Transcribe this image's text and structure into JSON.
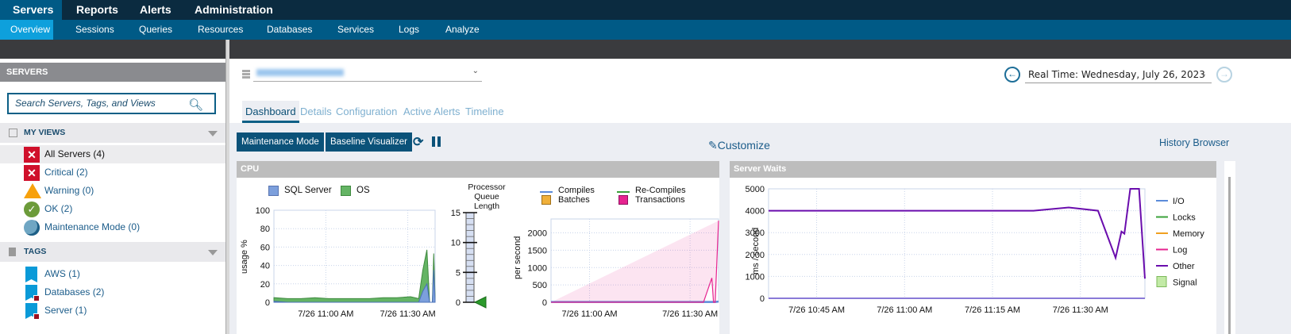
{
  "topnav": {
    "items": [
      "Servers",
      "Reports",
      "Alerts",
      "Administration"
    ],
    "active": "Servers"
  },
  "subnav": {
    "items": [
      "Overview",
      "Sessions",
      "Queries",
      "Resources",
      "Databases",
      "Services",
      "Logs",
      "Analyze"
    ],
    "active": "Overview"
  },
  "sidebar": {
    "title": "SERVERS",
    "search_placeholder": "Search Servers, Tags, and Views",
    "my_views": {
      "label": "MY VIEWS",
      "items": [
        {
          "label": "All Servers (4)",
          "status": "critical",
          "selected": true
        },
        {
          "label": "Critical (2)",
          "status": "critical"
        },
        {
          "label": "Warning (0)",
          "status": "warning"
        },
        {
          "label": "OK (2)",
          "status": "ok"
        },
        {
          "label": "Maintenance Mode (0)",
          "status": "maintenance"
        }
      ]
    },
    "tags": {
      "label": "TAGS",
      "items": [
        {
          "label": "AWS (1)"
        },
        {
          "label": "Databases (2)"
        },
        {
          "label": "Server (1)"
        }
      ]
    }
  },
  "main": {
    "realtime_label": "Real Time: Wednesday, July 26, 2023",
    "tabs": [
      "Dashboard",
      "Details",
      "Configuration",
      "Active Alerts",
      "Timeline"
    ],
    "active_tab": "Dashboard",
    "buttons": {
      "maintenance": "Maintenance Mode",
      "baseline": "Baseline Visualizer"
    },
    "customize": "Customize",
    "history_browser": "History Browser"
  },
  "colors": {
    "sql": "#7c9fdc",
    "os": "#64b464",
    "compiles": "#5b8bd9",
    "recompiles": "#3aa13a",
    "batches": "#f0b03a",
    "transactions": "#e6248f",
    "io": "#5b8bd9",
    "locks": "#3aa13a",
    "memory": "#f0a020",
    "log": "#e6248f",
    "other": "#6a0dad",
    "signal": "#c2eaa6"
  },
  "chart_data": [
    {
      "type": "area",
      "title": "CPU",
      "ylabel": "usage %",
      "ylim": [
        0,
        100
      ],
      "yticks": [
        "0",
        "20",
        "40",
        "60",
        "80",
        "100"
      ],
      "xticks": [
        "7/26 11:00 AM",
        "7/26 11:30 AM"
      ],
      "xticks_min": [
        0,
        30
      ],
      "xlim_min": [
        -19,
        40
      ],
      "legend": [
        "SQL Server",
        "OS"
      ],
      "x_min": [
        -19,
        -14,
        -9,
        -4,
        1,
        6,
        11,
        16,
        21,
        26,
        31,
        34,
        35.5,
        37,
        38,
        39,
        39.5,
        40
      ],
      "series": [
        {
          "name": "OS",
          "values": [
            5,
            4,
            4,
            5,
            4,
            4,
            4,
            4,
            5,
            5,
            6,
            4,
            35,
            57,
            0,
            0,
            53,
            5
          ]
        },
        {
          "name": "SQL Server",
          "values": [
            1,
            0,
            0,
            0,
            0,
            0,
            0,
            0,
            0,
            0,
            0,
            0,
            12,
            20,
            0,
            0,
            35,
            3
          ]
        }
      ]
    },
    {
      "type": "gauge",
      "title": "Processor Queue Length",
      "range": [
        0,
        15
      ],
      "ticks": [
        "0",
        "5",
        "10",
        "15"
      ],
      "value": 0
    },
    {
      "type": "line",
      "ylabel": "per second",
      "ylim": [
        0,
        2400
      ],
      "yticks": [
        "0",
        "500",
        "1000",
        "1500",
        "2000"
      ],
      "xticks": [
        "7/26 11:00 AM",
        "7/26 11:30 AM"
      ],
      "xticks_min": [
        0,
        30
      ],
      "xlim_min": [
        -11.5,
        38.5
      ],
      "legend": [
        "Compiles",
        "Re-Compiles",
        "Batches",
        "Transactions"
      ],
      "x_min": [
        -11.5,
        30,
        34,
        36.5,
        37,
        37.5,
        38.5
      ],
      "series": [
        {
          "name": "Compiles",
          "values": [
            10,
            10,
            10,
            10,
            10,
            10,
            20
          ]
        },
        {
          "name": "Transactions",
          "values": [
            0,
            0,
            0,
            700,
            0,
            0,
            2350
          ]
        }
      ]
    },
    {
      "type": "line",
      "title": "Server Waits",
      "ylabel": "ms / second",
      "ylim": [
        0,
        5000
      ],
      "yticks": [
        "0",
        "1000",
        "2000",
        "3000",
        "4000",
        "5000"
      ],
      "xticks": [
        "7/26 10:45 AM",
        "7/26 11:00 AM",
        "7/26 11:15 AM",
        "7/26 11:30 AM"
      ],
      "xticks_min": [
        -15,
        0,
        15,
        30
      ],
      "xlim_min": [
        -23.2,
        41
      ],
      "legend": [
        "I/O",
        "Locks",
        "Memory",
        "Log",
        "Other",
        "Signal"
      ],
      "x_min": [
        -23.2,
        22,
        28,
        33,
        36,
        37,
        37.5,
        38.5,
        40,
        41
      ],
      "series": [
        {
          "name": "Other",
          "values": [
            4000,
            4000,
            4150,
            4000,
            1850,
            3050,
            2950,
            5000,
            5000,
            900
          ]
        },
        {
          "name": "I/O",
          "values": [
            0,
            0,
            0,
            0,
            0,
            0,
            0,
            0,
            0,
            0
          ]
        }
      ]
    }
  ]
}
